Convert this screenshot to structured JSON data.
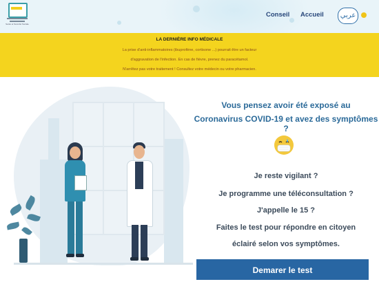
{
  "header": {
    "logo_text": "Santé et Sécurité Sociale",
    "nav": {
      "conseil": "Conseil",
      "accueil": "Accueil"
    },
    "lang_button": "عربي"
  },
  "banner": {
    "title": "LA DERNIÈRE INFO MÉDICALE",
    "lines": [
      "La prise d'anti-inflammatoires (ibuprofène, cortisone ...) pourrait être un facteur",
      "d'aggravation de l'infection. En cas de fièvre, prenez du paracétamol.",
      "N'arrêtez pas votre traitement ! Consultez votre médecin ou votre pharmacien."
    ]
  },
  "main": {
    "headline_1": "Vous pensez avoir été exposé au",
    "headline_2": "Coronavirus COVID-19 et avez des symptômes ?",
    "questions": [
      "Je reste vigilant ?",
      "Je programme une téléconsultation ?",
      "J'appelle le 15 ?",
      "Faites le test pour répondre en citoyen",
      "éclairé selon vos symptômes."
    ],
    "cta_label": "Demarer le test"
  },
  "colors": {
    "banner_bg": "#f4d41e",
    "primary_blue": "#2866a3",
    "headline_blue": "#2b6a99",
    "nurse_scrubs": "#2f8fb0"
  },
  "icons": {
    "logo": "ministry-logo",
    "sun": "sun-icon",
    "emoji": "masked-face-icon"
  }
}
